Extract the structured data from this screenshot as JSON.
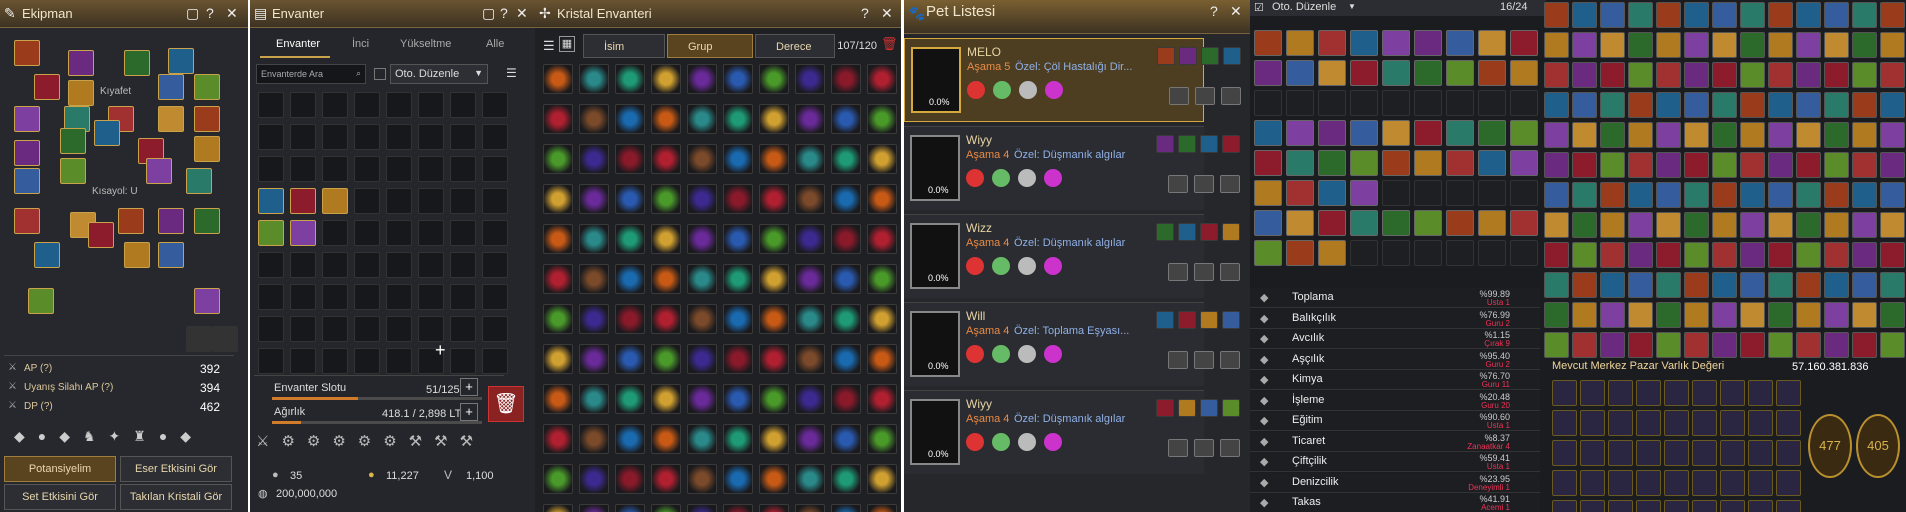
{
  "ekipman": {
    "title": "Ekipman",
    "kiyafet_label": "Kıyafet",
    "kisayol_label": "Kısayol: U",
    "stats": [
      {
        "label": "AP (?)",
        "value": "392"
      },
      {
        "label": "Uyanış Silahı AP (?)",
        "value": "394"
      },
      {
        "label": "DP (?)",
        "value": "462"
      }
    ],
    "buttons": [
      "Potansiyelim",
      "Eser Etkisini Gör",
      "Set Etkisini Gör",
      "Takılan Kristali Gör"
    ]
  },
  "envanter": {
    "title": "Envanter",
    "tabs": [
      "Envanter",
      "İnci",
      "Yükseltme",
      "Alle"
    ],
    "search_placeholder": "Envanterde Ara",
    "auto_sort": "Oto. Düzenle",
    "slot_label": "Envanter Slotu",
    "slot_value": "51/125",
    "weight_label": "Ağırlık",
    "weight_value": "418.1 / 2,898 LT",
    "currency1": "35",
    "currency2": "11,227",
    "currency3": "1,100",
    "silver": "200,000,000"
  },
  "kristal": {
    "title": "Kristal Envanteri",
    "col_isim": "İsim",
    "col_grup": "Grup",
    "col_derece": "Derece",
    "count": "107/120"
  },
  "pets": {
    "title": "Pet Listesi",
    "items": [
      {
        "name": "MELO",
        "stage": "Aşama 5",
        "desc": "Özel: Çöl Hastalığı Dir...",
        "pct": "0.0%",
        "color": "#d6a93c"
      },
      {
        "name": "Wiyy",
        "stage": "Aşama 4",
        "desc": "Özel: Düşmanık algılar",
        "pct": "0.0%",
        "color": "#888"
      },
      {
        "name": "Wizz",
        "stage": "Aşama 4",
        "desc": "Özel: Düşmanık algılar",
        "pct": "0.0%",
        "color": "#888"
      },
      {
        "name": "Will",
        "stage": "Aşama 4",
        "desc": "Özel: Toplama Eşyası...",
        "pct": "0.0%",
        "color": "#888"
      },
      {
        "name": "Wiyy",
        "stage": "Aşama 4",
        "desc": "Özel: Düşmanık algılar",
        "pct": "0.0%",
        "color": "#888"
      }
    ]
  },
  "depo": {
    "auto_sort": "Oto. Düzenle",
    "count": "16/24",
    "life": [
      {
        "name": "Toplama",
        "p": "%99.89",
        "g": "Usta 1"
      },
      {
        "name": "Balıkçılık",
        "p": "%76.99",
        "g": "Guru 2"
      },
      {
        "name": "Avcılık",
        "p": "%1.15",
        "g": "Çırak 9"
      },
      {
        "name": "Aşçılık",
        "p": "%95.40",
        "g": "Guru 2"
      },
      {
        "name": "Kimya",
        "p": "%76.70",
        "g": "Guru 11"
      },
      {
        "name": "İşleme",
        "p": "%20.48",
        "g": "Guru 20"
      },
      {
        "name": "Eğitim",
        "p": "%90.60",
        "g": "Usta 1"
      },
      {
        "name": "Ticaret",
        "p": "%8.37",
        "g": "Zanaatkar 4"
      },
      {
        "name": "Çiftçilik",
        "p": "%59.41",
        "g": "Usta 1"
      },
      {
        "name": "Denizcilik",
        "p": "%23.95",
        "g": "Deneyimli 1"
      },
      {
        "name": "Takas",
        "p": "%41.91",
        "g": "Acemi 1"
      }
    ],
    "market_label": "Mevcut Merkez Pazar Varlık Değeri",
    "market_value": "57.160.381.836",
    "medal1": "477",
    "medal2": "405"
  }
}
